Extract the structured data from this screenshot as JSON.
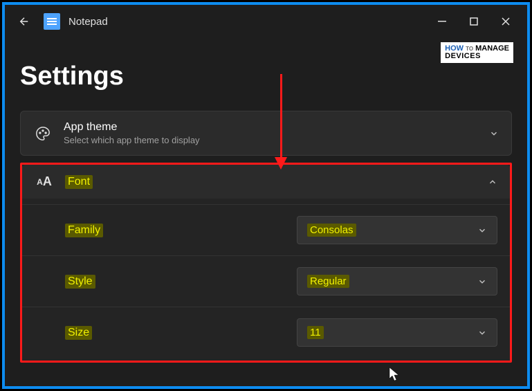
{
  "titlebar": {
    "app_name": "Notepad"
  },
  "page": {
    "title": "Settings"
  },
  "apptheme": {
    "title": "App theme",
    "subtitle": "Select which app theme to display"
  },
  "font": {
    "header_label": "Font",
    "family_label": "Family",
    "family_value": "Consolas",
    "style_label": "Style",
    "style_value": "Regular",
    "size_label": "Size",
    "size_value": "11"
  },
  "watermark": {
    "line1": "HOW",
    "line2": "MANAGE",
    "line3": "DEVICES"
  }
}
